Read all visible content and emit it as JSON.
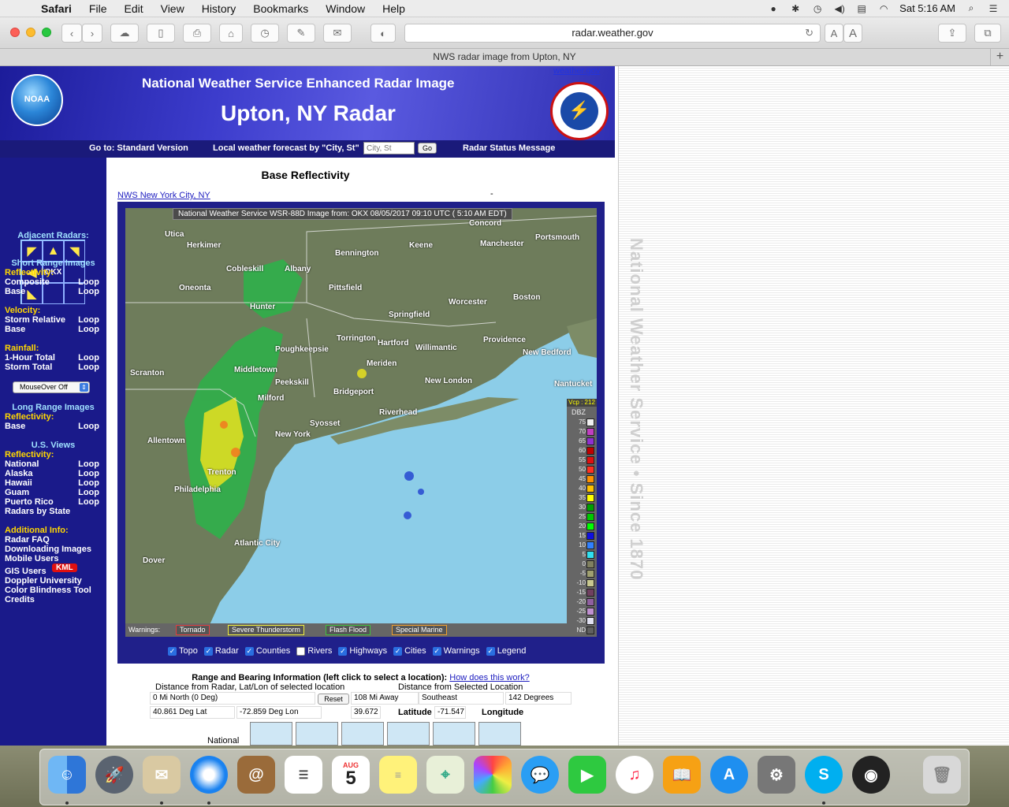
{
  "menubar": {
    "app": "Safari",
    "items": [
      "File",
      "Edit",
      "View",
      "History",
      "Bookmarks",
      "Window",
      "Help"
    ],
    "clock": "Sat 5:16 AM"
  },
  "browser": {
    "url": "radar.weather.gov",
    "tab_title": "NWS radar image from Upton, NY"
  },
  "header": {
    "noaa_logo": "NOAA",
    "subtitle": "National Weather Service Enhanced Radar Image",
    "title": "Upton, NY Radar",
    "weather_link": "weather.gov",
    "goto_label": "Go to: Standard Version",
    "forecast_label": "Local weather forecast by \"City, St\"",
    "city_placeholder": "City, St",
    "go_button": "Go",
    "status_link": "Radar Status Message"
  },
  "sidebar": {
    "adjacent_title": "Adjacent Radars:",
    "station": "OKX",
    "short_range_title": "Short Range Images",
    "reflectivity_label": "Reflectivity:",
    "composite": "Composite",
    "base": "Base",
    "loop": "Loop",
    "velocity_label": "Velocity:",
    "storm_relative": "Storm Relative",
    "rainfall_label": "Rainfall:",
    "one_hour": "1-Hour Total",
    "storm_total": "Storm Total",
    "mouseover": "MouseOver Off",
    "long_range_title": "Long Range Images",
    "us_views_title": "U.S. Views",
    "national": "National",
    "alaska": "Alaska",
    "hawaii": "Hawaii",
    "guam": "Guam",
    "puerto_rico": "Puerto Rico",
    "radars_by_state": "Radars by State",
    "additional_title": "Additional Info:",
    "radar_faq": "Radar FAQ",
    "downloading": "Downloading Images",
    "mobile": "Mobile Users",
    "gis": "GIS Users",
    "kml": "KML",
    "doppler": "Doppler University",
    "color_blind": "Color Blindness Tool",
    "credits": "Credits"
  },
  "content": {
    "product_title": "Base Reflectivity",
    "office_link": "NWS New York City, NY",
    "dash": "-",
    "caption": "National Weather Service WSR-88D Image  from: OKX  08/05/2017  09:10  UTC ( 5:10 AM EDT)",
    "warnings_label": "Warnings:",
    "warnings": [
      "Tornado",
      "Severe Thunderstorm",
      "Flash Flood",
      "Special Marine"
    ],
    "vcp": "Vcp : 212",
    "dbz_label": "DBZ",
    "legend": [
      "75",
      "70",
      "65",
      "60",
      "55",
      "50",
      "45",
      "40",
      "35",
      "30",
      "25",
      "20",
      "15",
      "10",
      "5",
      "0",
      "-5",
      "-10",
      "-15",
      "-20",
      "-25",
      "-30",
      "ND"
    ],
    "legend_colors": [
      "#f0f0f0",
      "#c040c0",
      "#9030d0",
      "#c00000",
      "#e01010",
      "#ff3020",
      "#ff9000",
      "#ffc000",
      "#ffff00",
      "#00a000",
      "#00c800",
      "#00ff00",
      "#1010e0",
      "#3080ff",
      "#30e0f0",
      "#808060",
      "#a0a070",
      "#c8c890",
      "#704060",
      "#9060a0",
      "#c090d0",
      "#e0e0f0",
      "#606060"
    ],
    "cities": [
      "Utica",
      "Herkimer",
      "Bennington",
      "Keene",
      "Manchester",
      "Portsmouth",
      "Cobleskill",
      "Albany",
      "Oneonta",
      "Pittsfield",
      "Hunter",
      "Worcester",
      "Boston",
      "Springfield",
      "Torrington",
      "Hartford",
      "Willimantic",
      "Providence",
      "New Bedford",
      "Poughkeepsie",
      "Meriden",
      "Scranton",
      "Middletown",
      "Peekskill",
      "New London",
      "Nantucket",
      "Bridgeport",
      "Riverhead",
      "Syosset",
      "New York",
      "Allentown",
      "Trenton",
      "Philadelphia",
      "Atlantic City",
      "Dover",
      "Concord",
      "Milford"
    ],
    "layers": [
      {
        "label": "Topo",
        "on": true
      },
      {
        "label": "Radar",
        "on": true
      },
      {
        "label": "Counties",
        "on": true
      },
      {
        "label": "Rivers",
        "on": false
      },
      {
        "label": "Highways",
        "on": true
      },
      {
        "label": "Cities",
        "on": true
      },
      {
        "label": "Warnings",
        "on": true
      },
      {
        "label": "Legend",
        "on": true
      }
    ],
    "range_title": "Range and Bearing Information (left click to select a location):",
    "range_link": "How does this work?",
    "dist_radar_hdr": "Distance from Radar, Lat/Lon of selected location",
    "dist_sel_hdr": "Distance from Selected Location",
    "mi_north": "0 Mi North (0 Deg)",
    "reset": "Reset",
    "mi_away": "108 Mi Away",
    "direction": "Southeast",
    "degrees": "142 Degrees",
    "lat": "40.861 Deg Lat",
    "lon": "-72.859 Deg Lon",
    "sel_lat": "39.672",
    "latitude_label": "Latitude",
    "sel_lon": "-71.547",
    "longitude_label": "Longitude",
    "national_label": "National",
    "side_watermark": "National Weather Service • Since 1870"
  },
  "dock": {
    "calendar_month": "AUG",
    "calendar_day": "5"
  }
}
